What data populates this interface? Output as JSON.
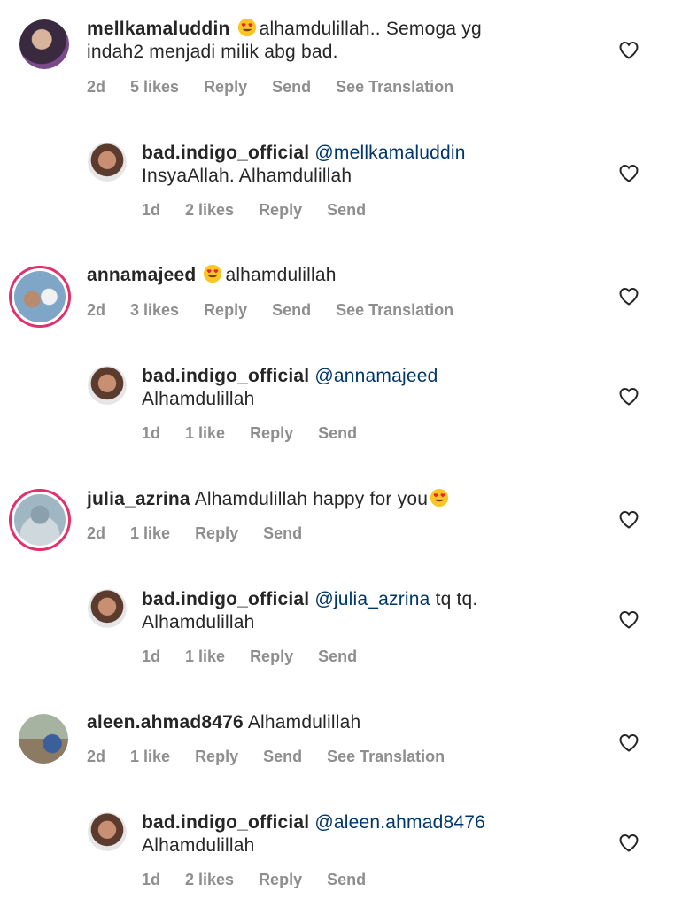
{
  "comments": [
    {
      "username": "mellkamaluddin",
      "text": "alhamdulillah.. Semoga yg",
      "text2": "indah2 menjadi milik abg bad.",
      "time": "2d",
      "likes": "5 likes",
      "reply": "Reply",
      "send": "Send",
      "translate": "See Translation"
    },
    {
      "username": "bad.indigo_official",
      "mention": "@mellkamaluddin",
      "text2": "InsyaAllah. Alhamdulillah",
      "time": "1d",
      "likes": "2 likes",
      "reply": "Reply",
      "send": "Send"
    },
    {
      "username": "annamajeed",
      "text": "alhamdulillah",
      "time": "2d",
      "likes": "3 likes",
      "reply": "Reply",
      "send": "Send",
      "translate": "See Translation"
    },
    {
      "username": "bad.indigo_official",
      "mention": "@annamajeed",
      "text2": "Alhamdulillah",
      "time": "1d",
      "likes": "1 like",
      "reply": "Reply",
      "send": "Send"
    },
    {
      "username": "julia_azrina",
      "text": "Alhamdulillah happy for you",
      "time": "2d",
      "likes": "1 like",
      "reply": "Reply",
      "send": "Send"
    },
    {
      "username": "bad.indigo_official",
      "mention": "@julia_azrina",
      "text": "tq tq.",
      "text2": "Alhamdulillah",
      "time": "1d",
      "likes": "1 like",
      "reply": "Reply",
      "send": "Send"
    },
    {
      "username": "aleen.ahmad8476",
      "text": "Alhamdulillah",
      "time": "2d",
      "likes": "1 like",
      "reply": "Reply",
      "send": "Send",
      "translate": "See Translation"
    },
    {
      "username": "bad.indigo_official",
      "mention": "@aleen.ahmad8476",
      "text2": "Alhamdulillah",
      "time": "1d",
      "likes": "2 likes",
      "reply": "Reply",
      "send": "Send"
    }
  ],
  "icons": {
    "like": "heart-icon",
    "emoji": "heart-eyes-emoji"
  },
  "colors": {
    "meta": "#8e8e8e",
    "mention": "#00376b",
    "story_ring": "#e1306c"
  }
}
